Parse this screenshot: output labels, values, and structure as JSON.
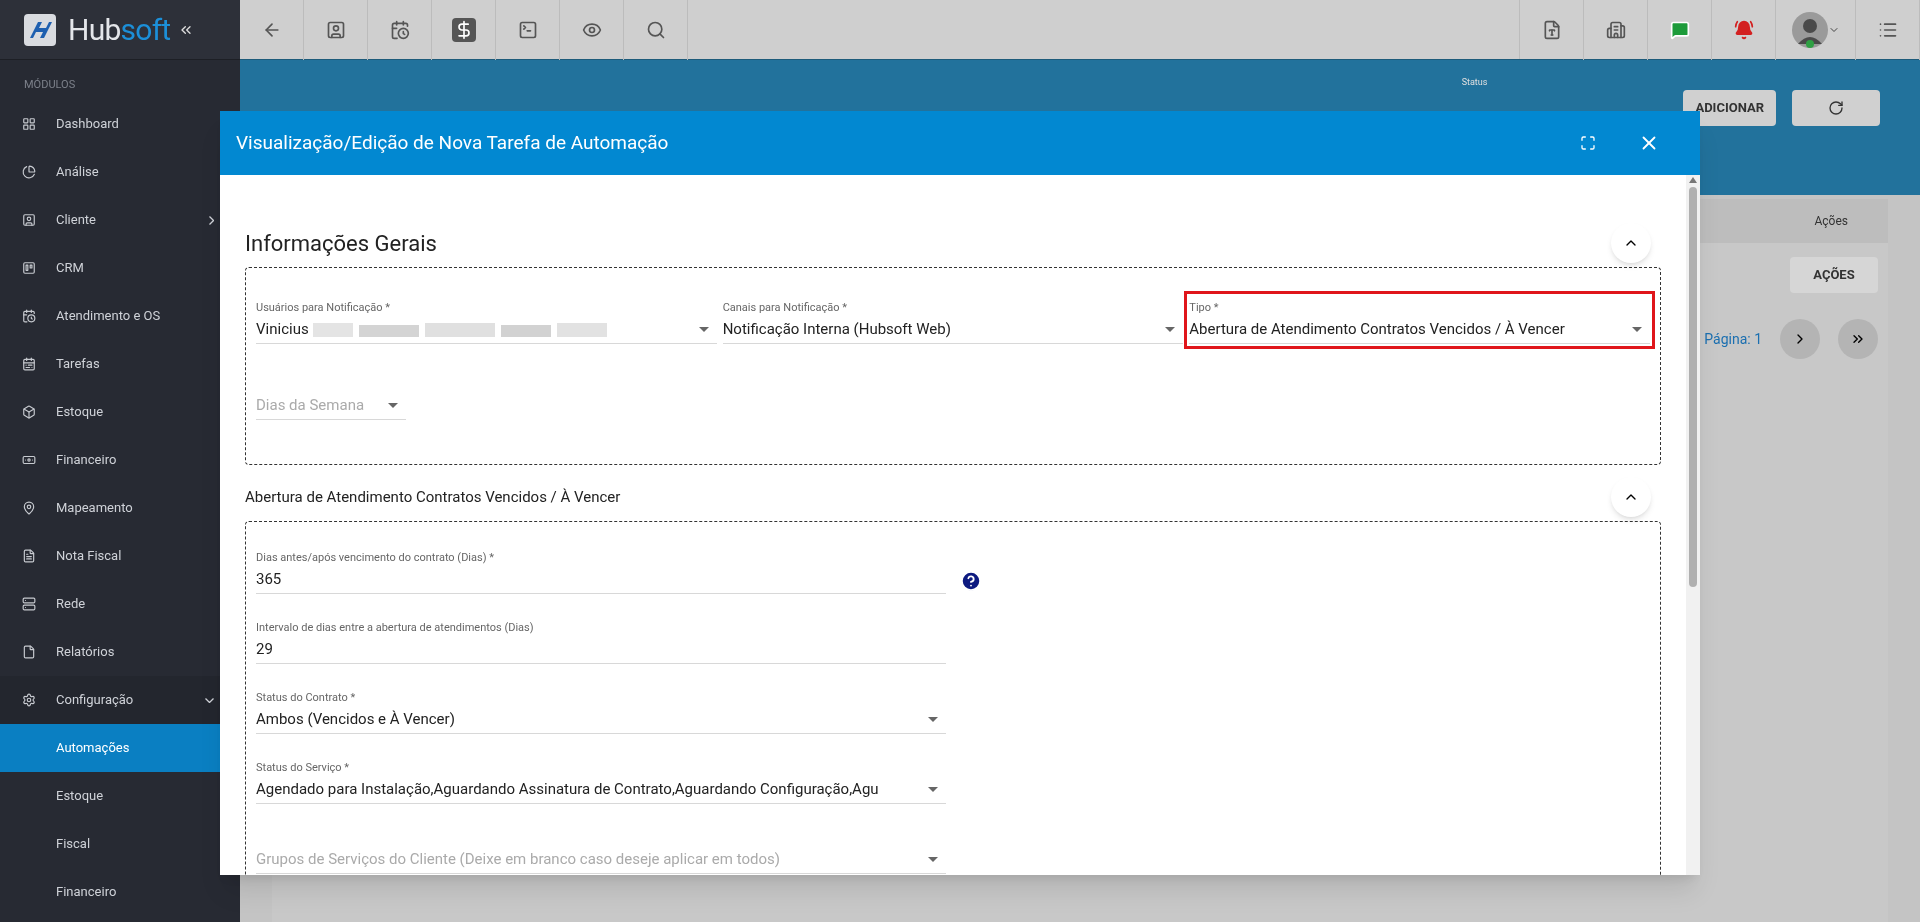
{
  "sidebar": {
    "brand": {
      "first": "Hub",
      "second": "soft"
    },
    "section_label": "MÓDULOS",
    "items": [
      {
        "label": "Dashboard",
        "selected": false
      },
      {
        "label": "Análise",
        "selected": false
      },
      {
        "label": "Cliente",
        "selected": false,
        "expanded": false
      },
      {
        "label": "CRM",
        "selected": false
      },
      {
        "label": "Atendimento e OS",
        "selected": false
      },
      {
        "label": "Tarefas",
        "selected": false
      },
      {
        "label": "Estoque",
        "selected": false
      },
      {
        "label": "Financeiro",
        "selected": false
      },
      {
        "label": "Mapeamento",
        "selected": false
      },
      {
        "label": "Nota Fiscal",
        "selected": false
      },
      {
        "label": "Rede",
        "selected": false
      },
      {
        "label": "Relatórios",
        "selected": false
      },
      {
        "label": "Configuração",
        "selected": false,
        "expanded": true,
        "children": [
          {
            "label": "Automações",
            "selected": true
          },
          {
            "label": "Estoque",
            "selected": false
          },
          {
            "label": "Fiscal",
            "selected": false
          },
          {
            "label": "Financeiro",
            "selected": false
          }
        ]
      }
    ]
  },
  "background_page": {
    "status_label": "Status",
    "add_button": "ADICIONAR",
    "column": "Ações",
    "actions_button": "AÇÕES",
    "pagination": "Página: 1"
  },
  "modal": {
    "title": "Visualização/Edição de Nova Tarefa de Automação",
    "sections": [
      {
        "title": "Informações Gerais",
        "kind": "main",
        "expanded": true,
        "rows": [
          [
            {
              "kind": "select",
              "label": "Usuários para Notificação *",
              "value": "Vinicius",
              "redacted": true,
              "highlighted": false
            },
            {
              "kind": "select",
              "label": "Canais para Notificação *",
              "value": "Notificação Interna (Hubsoft Web)",
              "highlighted": false
            },
            {
              "kind": "select",
              "label": "Tipo *",
              "value": "Abertura de Atendimento Contratos Vencidos / À Vencer",
              "highlighted": true
            }
          ],
          [
            {
              "kind": "select",
              "placeholder": "Dias da Semana",
              "highlighted": false
            }
          ]
        ]
      },
      {
        "title": "Abertura de Atendimento Contratos Vencidos / À Vencer",
        "kind": "sub",
        "expanded": true,
        "rows": [
          [
            {
              "kind": "text",
              "label": "Dias antes/após vencimento do contrato (Dias) *",
              "value": "365",
              "help": true
            }
          ],
          [
            {
              "kind": "text",
              "label": "Intervalo de dias entre a abertura de atendimentos (Dias)",
              "value": "29"
            }
          ],
          [
            {
              "kind": "select",
              "label": "Status do Contrato *",
              "value": "Ambos (Vencidos e À Vencer)"
            }
          ],
          [
            {
              "kind": "select",
              "label": "Status do Serviço *",
              "value": "Agendado para Instalação,Aguardando Assinatura de Contrato,Aguardando Configuração,Agu"
            }
          ],
          [
            {
              "kind": "select",
              "placeholder": "Grupos de Serviços do Cliente (Deixe em branco caso deseje aplicar em todos)"
            }
          ]
        ]
      }
    ]
  }
}
